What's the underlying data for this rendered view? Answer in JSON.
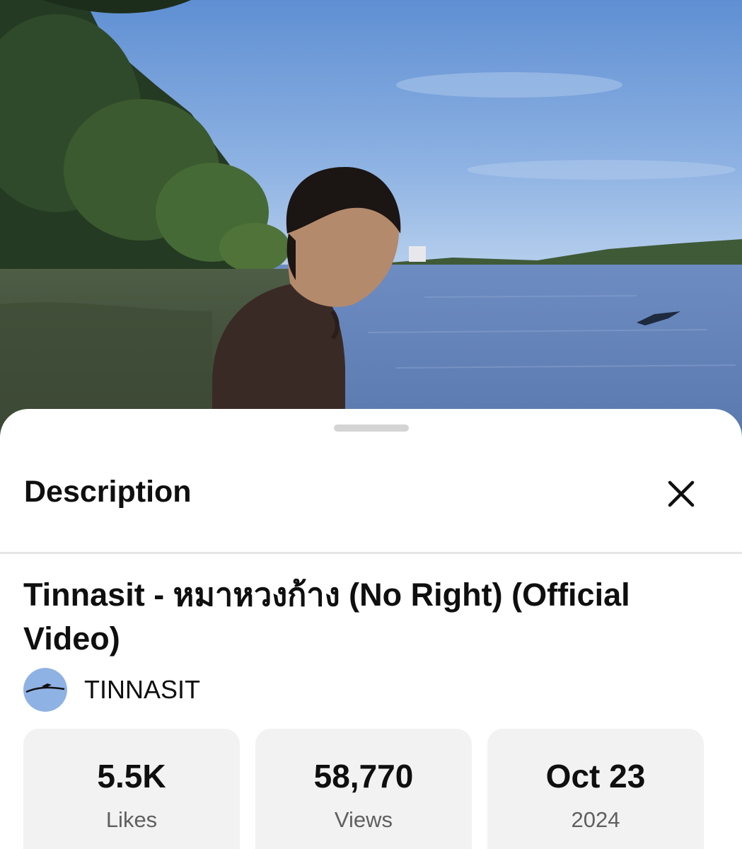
{
  "video": {
    "thumbnail": "lakeside-scene"
  },
  "sheet": {
    "title": "Description",
    "close_icon": "close-icon"
  },
  "video_info": {
    "title": "Tinnasit - หมาหวงก้าง (No Right) (Official Video)",
    "channel_name": "TINNASIT",
    "avatar_icon": "channel-avatar"
  },
  "stats": {
    "likes_value": "5.5K",
    "likes_label": "Likes",
    "views_value": "58,770",
    "views_label": "Views",
    "date_value": "Oct 23",
    "date_label": "2024"
  },
  "colors": {
    "sheet_background": "#ffffff",
    "card_background": "#f2f2f2",
    "primary_text": "#0f0f0f",
    "secondary_text": "#606060"
  }
}
